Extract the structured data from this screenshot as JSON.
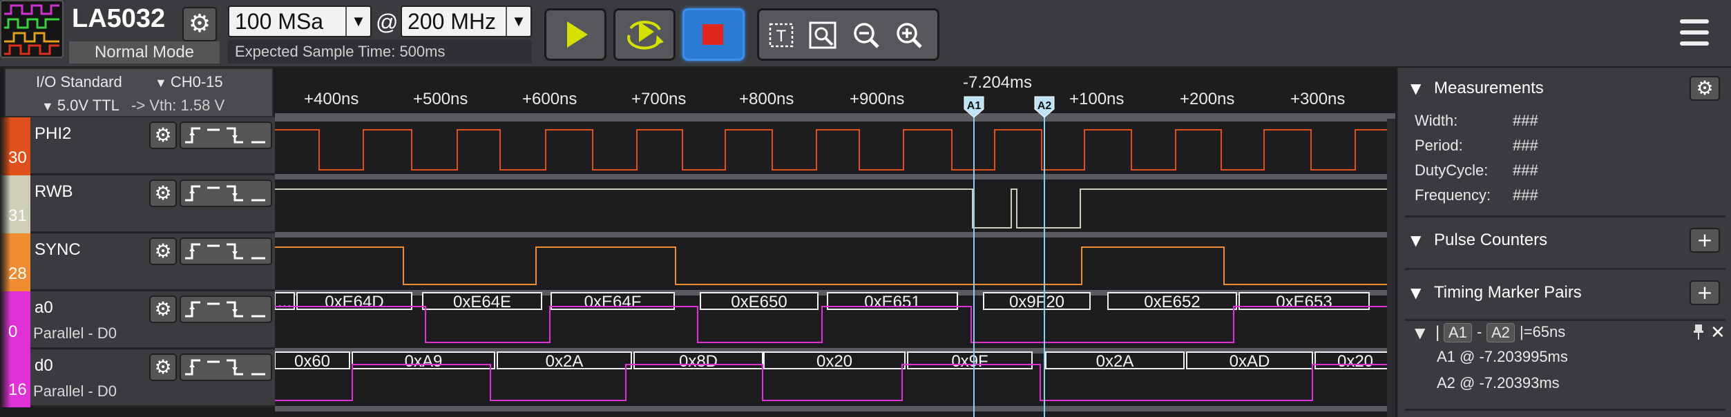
{
  "toolbar": {
    "device_name": "LA5032",
    "mode": "Normal Mode",
    "sample_rate": "100 MSa",
    "at": "@",
    "sample_freq": "200 MHz",
    "sample_time": "Expected Sample Time: 500ms",
    "run_color": "#d4e000",
    "stop_color": "#e0261e"
  },
  "left_header": {
    "io_standard": "I/O Standard",
    "channels": "CH0-15",
    "voltage": "5.0V TTL",
    "vth": "-> Vth:  1.58 V"
  },
  "channels": [
    {
      "num": "30",
      "name": "PHI2",
      "sub": "",
      "color": "#e0501a"
    },
    {
      "num": "31",
      "name": "RWB",
      "sub": "",
      "color": "#cfcfb8"
    },
    {
      "num": "28",
      "name": "SYNC",
      "sub": "",
      "color": "#f08c30"
    },
    {
      "num": "0",
      "name": "a0",
      "sub": "Parallel - D0",
      "color": "#e030d8"
    },
    {
      "num": "16",
      "name": "d0",
      "sub": "Parallel - D0",
      "color": "#e030d8"
    }
  ],
  "ruler": {
    "ticks": [
      "+400ns",
      "+500ns",
      "+600ns",
      "+700ns",
      "+800ns",
      "+900ns",
      "+100ns",
      "+200ns",
      "+300ns"
    ],
    "center_time": "-7.204ms",
    "marker_a1": "A1",
    "marker_a2": "A2"
  },
  "bus_a0": [
    "...",
    "0xE64D",
    "0xE64E",
    "0xE64F",
    "0xE650",
    "0xE651",
    "0x9F20",
    "0xE652",
    "0xE653"
  ],
  "bus_d0": [
    "0x60",
    "0xA9",
    "0x2A",
    "0x8D",
    "0x20",
    "0x9F",
    "0x2A",
    "0xAD",
    "0x20"
  ],
  "right_panel": {
    "measurements_title": "Measurements",
    "measurements": [
      {
        "label": "Width:",
        "value": "###"
      },
      {
        "label": "Period:",
        "value": "###"
      },
      {
        "label": "DutyCycle:",
        "value": "###"
      },
      {
        "label": "Frequency:",
        "value": "###"
      }
    ],
    "pulse_counters_title": "Pulse Counters",
    "timing_title": "Timing Marker Pairs",
    "pair_a1": "A1",
    "pair_a2": "A2",
    "pair_diff": "=65ns",
    "a1_pos": "A1 @ -7.203995ms",
    "a2_pos": "A2 @ -7.20393ms"
  }
}
